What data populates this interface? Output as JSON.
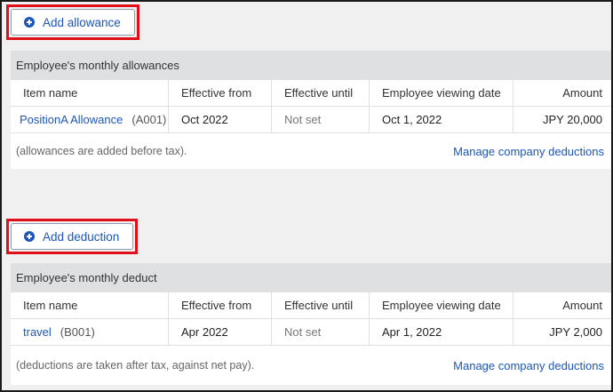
{
  "allowances": {
    "add_button_label": "Add allowance",
    "panel_title": "Employee's monthly allowances",
    "columns": [
      "Item name",
      "Effective from",
      "Effective until",
      "Employee viewing date",
      "Amount"
    ],
    "rows": [
      {
        "name": "PositionA Allowance",
        "code": "(A001)",
        "effective_from": "Oct 2022",
        "effective_until": "Not set",
        "viewing_date": "Oct 1, 2022",
        "amount": "JPY 20,000"
      }
    ],
    "footer_note": "(allowances are added before tax).",
    "manage_link": "Manage company deductions"
  },
  "deductions": {
    "add_button_label": "Add deduction",
    "panel_title": "Employee's monthly deduct",
    "columns": [
      "Item name",
      "Effective from",
      "Effective until",
      "Employee viewing date",
      "Amount"
    ],
    "rows": [
      {
        "name": "travel",
        "code": "(B001)",
        "effective_from": "Apr 2022",
        "effective_until": "Not set",
        "viewing_date": "Apr 1, 2022",
        "amount": "JPY 2,000"
      }
    ],
    "footer_note": "(deductions are taken after tax, against net pay).",
    "manage_link": "Manage company deductions"
  },
  "colors": {
    "accent": "#1b56b8",
    "highlight": "#e0101a",
    "panel_header": "#dfe0e2"
  },
  "icons": {
    "add": "plus-circle-icon"
  }
}
